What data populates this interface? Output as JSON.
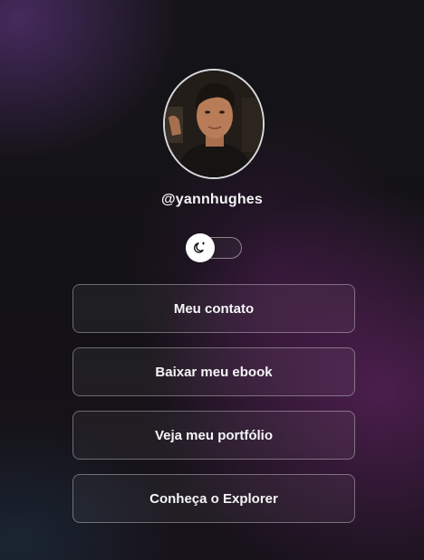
{
  "profile": {
    "username": "@yannhughes",
    "avatar_icon": "profile-photo"
  },
  "theme_toggle": {
    "icon": "moon-sun-icon",
    "state": "dark"
  },
  "links": [
    {
      "label": "Meu contato"
    },
    {
      "label": "Baixar meu ebook"
    },
    {
      "label": "Veja meu portfólio"
    },
    {
      "label": "Conheça o Explorer"
    }
  ],
  "colors": {
    "background": "#121214",
    "accent_glow": "#7a2c7a",
    "text": "#f5f5f7",
    "border": "#d9d9dc"
  }
}
